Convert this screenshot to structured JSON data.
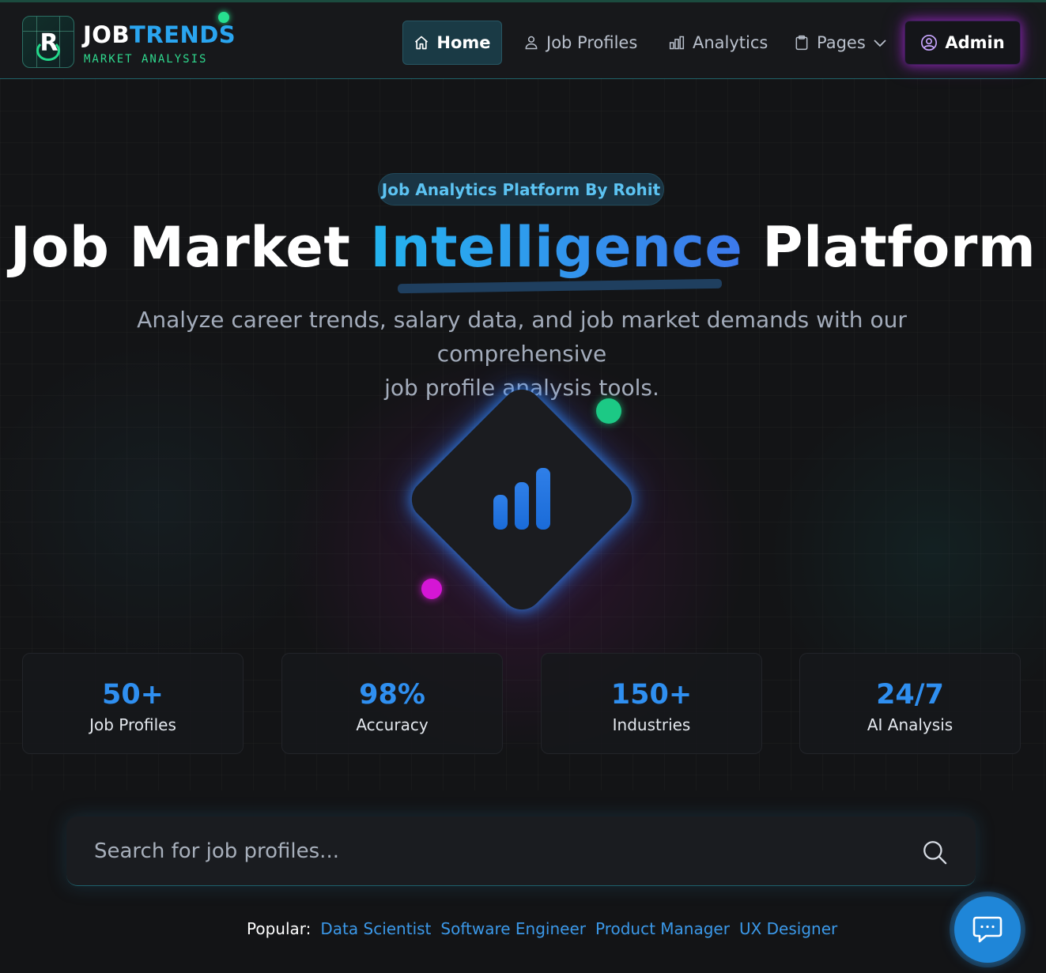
{
  "brand": {
    "title_white": "JOB",
    "title_blue": "TRENDS",
    "subtitle": "MARKET ANALYSIS",
    "logo_letter": "R"
  },
  "nav": {
    "items": [
      {
        "label": "Home",
        "icon": "home-icon",
        "active": true
      },
      {
        "label": "Job Profiles",
        "icon": "user-icon"
      },
      {
        "label": "Analytics",
        "icon": "bar-chart-icon"
      },
      {
        "label": "Pages",
        "icon": "clipboard-icon",
        "dropdown": true
      }
    ],
    "admin": {
      "label": "Admin",
      "icon": "user-circle-icon"
    }
  },
  "hero": {
    "badge": "Job Analytics Platform By Rohit",
    "title_part1": "Job Market ",
    "title_highlight": "Intelligence",
    "title_part2": " Platform",
    "subtitle_line1": "Analyze career trends, salary data, and job market demands with our comprehensive",
    "subtitle_line2": "job profile analysis tools."
  },
  "stats": [
    {
      "value": "50+",
      "label": "Job Profiles"
    },
    {
      "value": "98%",
      "label": "Accuracy"
    },
    {
      "value": "150+",
      "label": "Industries"
    },
    {
      "value": "24/7",
      "label": "AI Analysis"
    }
  ],
  "search": {
    "placeholder": "Search for job profiles...",
    "value": ""
  },
  "popular": {
    "label": "Popular:",
    "tags": [
      "Data Scientist",
      "Software Engineer",
      "Product Manager",
      "UX Designer"
    ]
  },
  "colors": {
    "accent_blue": "#2f8ff0",
    "accent_green": "#27e08f",
    "accent_magenta": "#d516d5",
    "background": "#131416"
  }
}
